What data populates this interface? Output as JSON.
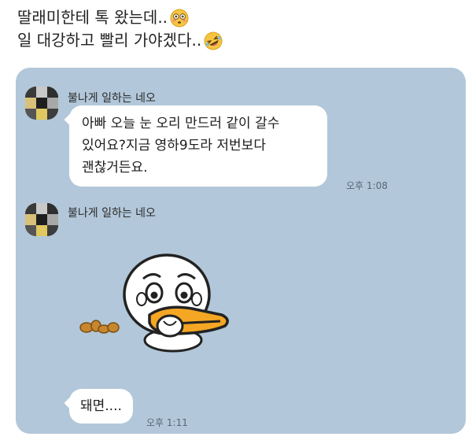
{
  "caption": {
    "line1": "딸래미한테 톡 왔는데..",
    "line1_emoji": "flushed-face-emoji",
    "line2": "일 대강하고 빨리 가야겠다..",
    "line2_emoji": "rolling-on-floor-laughing-emoji"
  },
  "chat": {
    "background": "#b2c7d9",
    "messages": [
      {
        "sender": "불나게 일하는 네오",
        "text": "아빠 오늘 눈 오리 만드러 같이 갈수\n있어요?지금 영하9도라  저번보다\n괜찮거든요.",
        "time": "오후 1:08"
      },
      {
        "sender": "불나게 일하는 네오",
        "sticker": "duck-sticker",
        "text": "돼면....",
        "time": "오후 1:11"
      }
    ]
  }
}
